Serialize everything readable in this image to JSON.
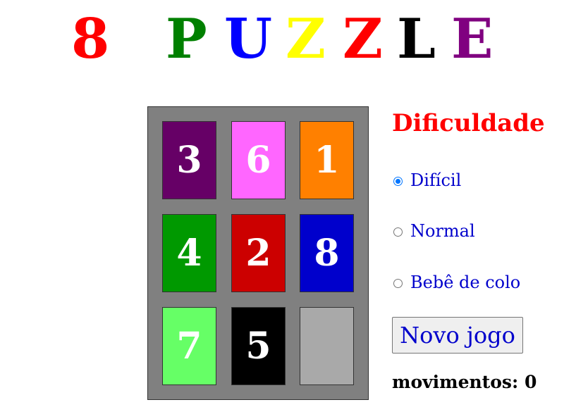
{
  "title": {
    "letters": [
      {
        "char": "8",
        "color": "#ff0000"
      },
      {
        "char": "P",
        "color": "#008000"
      },
      {
        "char": "U",
        "color": "#0000ff"
      },
      {
        "char": "Z",
        "color": "#ffff00"
      },
      {
        "char": "Z",
        "color": "#ff0000"
      },
      {
        "char": "L",
        "color": "#000000"
      },
      {
        "char": "E",
        "color": "#800080"
      }
    ]
  },
  "board": {
    "tiles": [
      {
        "label": "3",
        "color": "#660066"
      },
      {
        "label": "6",
        "color": "#ff66ff"
      },
      {
        "label": "1",
        "color": "#ff8000"
      },
      {
        "label": "4",
        "color": "#009900"
      },
      {
        "label": "2",
        "color": "#cc0000"
      },
      {
        "label": "8",
        "color": "#0000cc"
      },
      {
        "label": "7",
        "color": "#66ff66"
      },
      {
        "label": "5",
        "color": "#000000"
      },
      {
        "label": "",
        "color": "#a9a9a9",
        "empty": true
      }
    ]
  },
  "difficulty": {
    "heading": "Dificuldade",
    "options": [
      {
        "label": "Difícil",
        "checked": true
      },
      {
        "label": "Normal",
        "checked": false
      },
      {
        "label": "Bebê de colo",
        "checked": false
      }
    ]
  },
  "new_game_label": "Novo jogo",
  "moves": {
    "label": "movimentos:",
    "count": "0"
  }
}
